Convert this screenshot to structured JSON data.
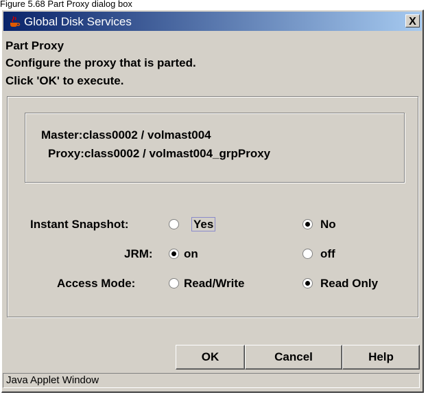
{
  "page_caption": "Figure 5.68 Part Proxy dialog box",
  "window": {
    "title": "Global Disk Services",
    "close_label": "X"
  },
  "dialog": {
    "heading": "Part Proxy",
    "line1": "Configure the proxy that is parted.",
    "line2": "Click 'OK' to execute."
  },
  "info": {
    "master": "Master:class0002 / volmast004",
    "proxy": "Proxy:class0002 / volmast004_grpProxy"
  },
  "options": {
    "instant_snapshot": {
      "label": "Instant Snapshot:",
      "opt1": "Yes",
      "opt2": "No",
      "selected": "No"
    },
    "jrm": {
      "label": "JRM:",
      "opt1": "on",
      "opt2": "off",
      "selected": "on"
    },
    "access_mode": {
      "label": "Access Mode:",
      "opt1": "Read/Write",
      "opt2": "Read Only",
      "selected": "Read Only"
    }
  },
  "buttons": {
    "ok": "OK",
    "cancel": "Cancel",
    "help": "Help"
  },
  "status_bar": "Java Applet Window"
}
